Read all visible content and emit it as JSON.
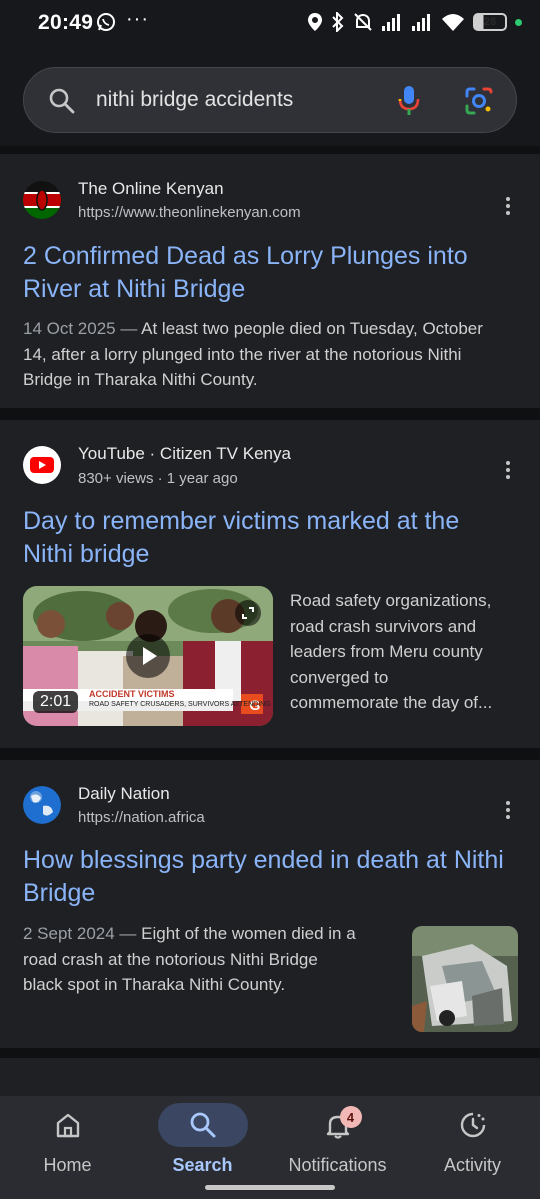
{
  "status": {
    "time": "20:49",
    "battery": "28"
  },
  "search": {
    "query": "nithi bridge accidents"
  },
  "results": [
    {
      "site": "The Online Kenyan",
      "url": "https://www.theonlinekenyan.com",
      "title_line1": "2 Confirmed Dead as Lorry Plunges into",
      "title_line2": "River at Nithi Bridge",
      "date": "14 Oct 2025",
      "snippet_line1": "At least two people died on Tuesday, October",
      "snippet_line2": "14, after a lorry plunged into the river at the notorious Nithi",
      "snippet_line3": "Bridge in Tharaka Nithi County."
    },
    {
      "site": "YouTube · Citizen TV Kenya",
      "meta": "830+ views · 1 year ago",
      "title_line1": "Day to remember victims marked at the",
      "title_line2": "Nithi bridge",
      "duration": "2:01",
      "ticker_top": "ACCIDENT VICTIMS",
      "ticker_bottom": "ROAD SAFETY CRUSADERS, SURVIVORS ATTENDING",
      "snippet_line1": "Road safety organizations,",
      "snippet_line2": "road crash survivors and",
      "snippet_line3": "leaders from Meru county",
      "snippet_line4": "converged to",
      "snippet_line5": "commemorate the day of..."
    },
    {
      "site": "Daily Nation",
      "url": "https://nation.africa",
      "title_line1": "How blessings party ended in death at Nithi",
      "title_line2": "Bridge",
      "date": "2 Sept 2024",
      "snippet_line1": "Eight of the women died in a",
      "snippet_line2": "road crash at the notorious Nithi Bridge",
      "snippet_line3": "black spot in Tharaka Nithi County."
    }
  ],
  "nav": {
    "home": "Home",
    "search": "Search",
    "notifications": "Notifications",
    "notifications_count": "4",
    "activity": "Activity"
  },
  "colors": {
    "link": "#8ab4f8",
    "background": "#1f2024",
    "active_pill": "#3a4662"
  }
}
